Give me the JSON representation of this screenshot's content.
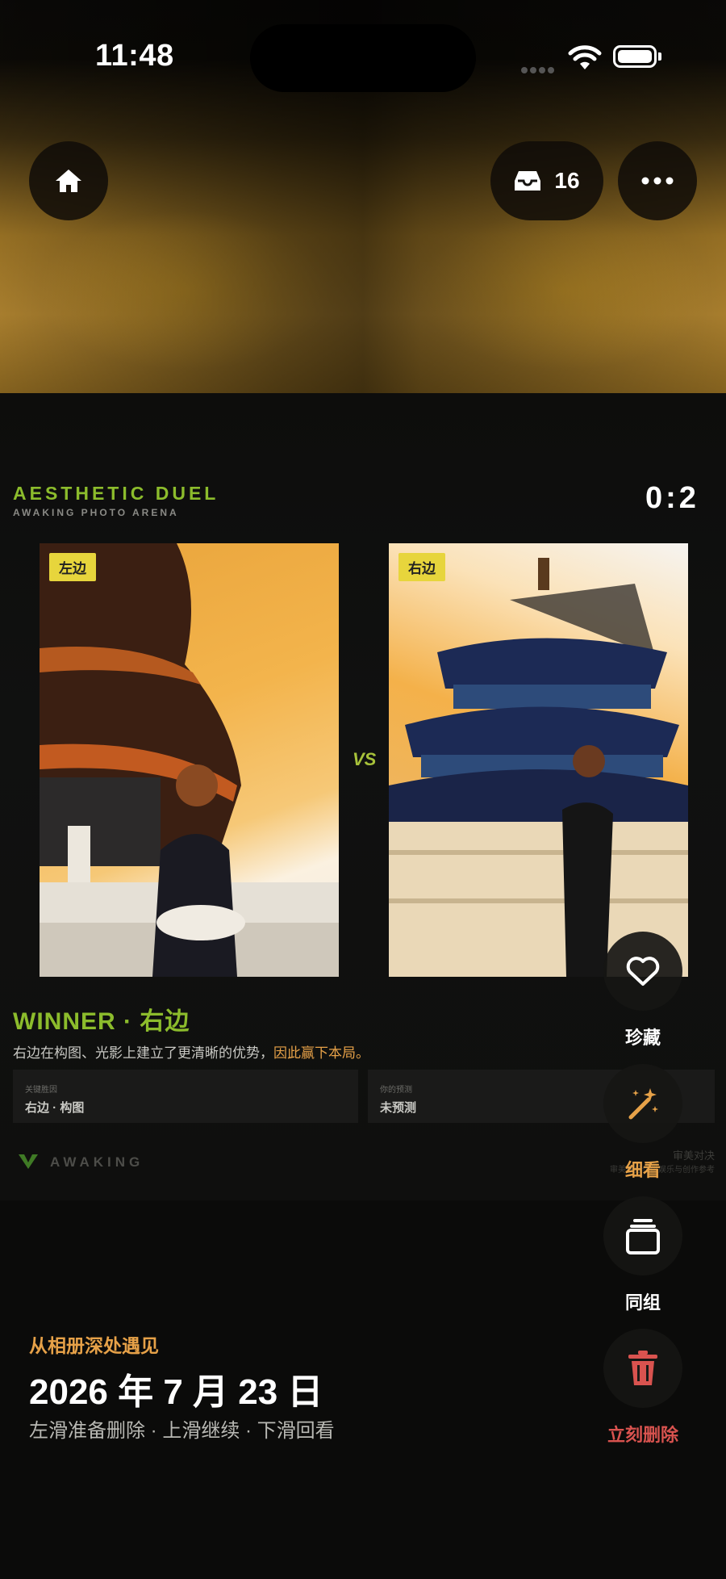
{
  "status_bar": {
    "time": "11:48"
  },
  "top_bar": {
    "inbox_count": "16"
  },
  "card": {
    "title": "AESTHETIC DUEL",
    "subtitle": "AWAKING PHOTO ARENA",
    "score": "0:2",
    "left_tag": "左边",
    "right_tag": "右边",
    "vs_label": "VS",
    "winner": "WINNER · 右边",
    "reason_main": "右边在构图、光影上建立了更清晰的优势，",
    "reason_accent": "因此赢下本局。",
    "info_left_label": "关键胜因",
    "info_left_value": "右边 · 构图",
    "info_right_label": "你的预测",
    "info_right_value": "未预测",
    "brand": "AWAKING",
    "footer_line1": "审美对决",
    "footer_line2": "审美评分仅供娱乐与创作参考"
  },
  "actions": {
    "favorite": "珍藏",
    "detail": "细看",
    "group": "同组",
    "delete": "立刻删除"
  },
  "bottom": {
    "source": "从相册深处遇见",
    "date": "2026 年 7 月 23 日",
    "hint": "左滑准备删除 · 上滑继续 · 下滑回看"
  },
  "colors": {
    "accent_orange": "#e6a148",
    "accent_green": "#8cbc2c",
    "delete_red": "#d9534f"
  },
  "icons": [
    "home-icon",
    "inbox-icon",
    "more-icon",
    "heart-icon",
    "magic-wand-icon",
    "stack-icon",
    "trash-icon"
  ]
}
